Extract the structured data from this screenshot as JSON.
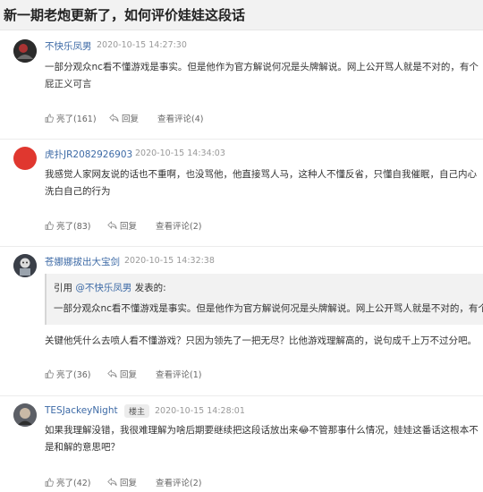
{
  "page_title": "新一期老炮更新了，如何评价娃娃这段话",
  "comments": [
    {
      "username": "不快乐凤男",
      "time": "2020-10-15 14:27:30",
      "text": "一部分观众nc看不懂游戏是事实。但是他作为官方解说何况是头牌解说。网上公开骂人就是不对的，有个屁正义可言",
      "likes": "亮了(161)",
      "reply": "回复",
      "view": "查看评论(4)"
    },
    {
      "username": "虎扑JR2082926903",
      "time": "2020-10-15 14:34:03",
      "text": "我感觉人家网友说的话也不重啊，也没骂他，他直接骂人马，这种人不懂反省，只懂自我催眠，自己内心洗白自己的行为",
      "likes": "亮了(83)",
      "reply": "回复",
      "view": "查看评论(2)"
    },
    {
      "username": "苍娜娜拔出大宝剑",
      "time": "2020-10-15 14:32:38",
      "quote_prefix": "引用 ",
      "quote_user": "@不快乐凤男",
      "quote_suffix": " 发表的:",
      "quote_text": "一部分观众nc看不懂游戏是事实。但是他作为官方解说何况是头牌解说。网上公开骂人就是不对的，有个屁正义可言",
      "text": "关键他凭什么去喷人看不懂游戏？只因为领先了一把无尽？比他游戏理解高的，说句成千上万不过分吧。",
      "likes": "亮了(36)",
      "reply": "回复",
      "view": "查看评论(1)"
    },
    {
      "username": "TESJackeyNight",
      "badge": "楼主",
      "time": "2020-10-15 14:28:01",
      "text": "如果我理解没错，我很难理解为啥后期要继续把这段话放出来😂不管那事什么情况，娃娃这番话这根本不是和解的意思吧？",
      "likes": "亮了(42)",
      "reply": "回复",
      "view": "查看评论(2)"
    }
  ]
}
